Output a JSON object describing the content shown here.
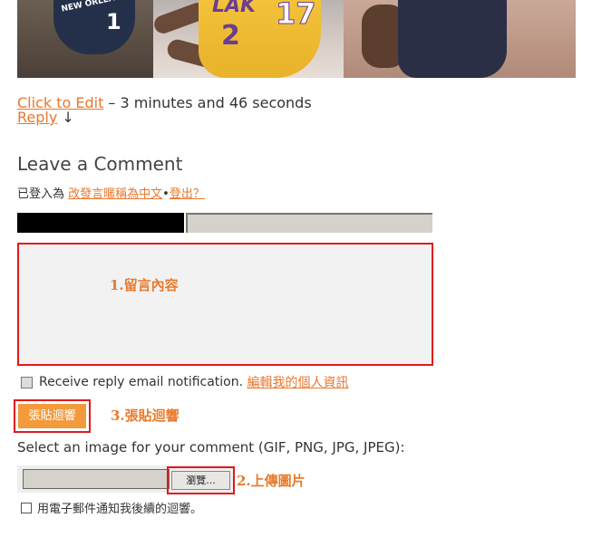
{
  "post": {
    "edit_link": "Click to Edit",
    "duration": " – 3 minutes and 46 seconds",
    "reply_link": "Reply",
    "reply_arrow": "↓"
  },
  "photo": {
    "jersey_left_text": "NEW ORLEANS",
    "jersey_left_number": "1",
    "lakers_text": "LAK",
    "lakers_number_a": "2",
    "lakers_number_b": "17"
  },
  "comment_form": {
    "heading": "Leave a Comment",
    "logged_in_prefix": "已登入為",
    "change_name_link": "改發言暱稱為中文",
    "dot": "•",
    "logout_link": "登出？",
    "comment_annotation": "1.留言內容",
    "reply_notify_label": "Receive reply email notification.",
    "edit_profile_link": "編輯我的個人資訊",
    "submit_label": "張貼迴響",
    "submit_annotation": "3.張貼迴響",
    "image_label": "Select an image for your comment (GIF, PNG, JPG, JPEG):",
    "browse_label": "瀏覽...",
    "upload_annotation": "2.上傳圖片",
    "email_notify_label": "用電子郵件通知我後續的迴響。"
  },
  "colors": {
    "link": "#e8772e",
    "highlight_border": "#e21a1a",
    "button": "#f39a3d",
    "annotation": "#e87a2a"
  }
}
